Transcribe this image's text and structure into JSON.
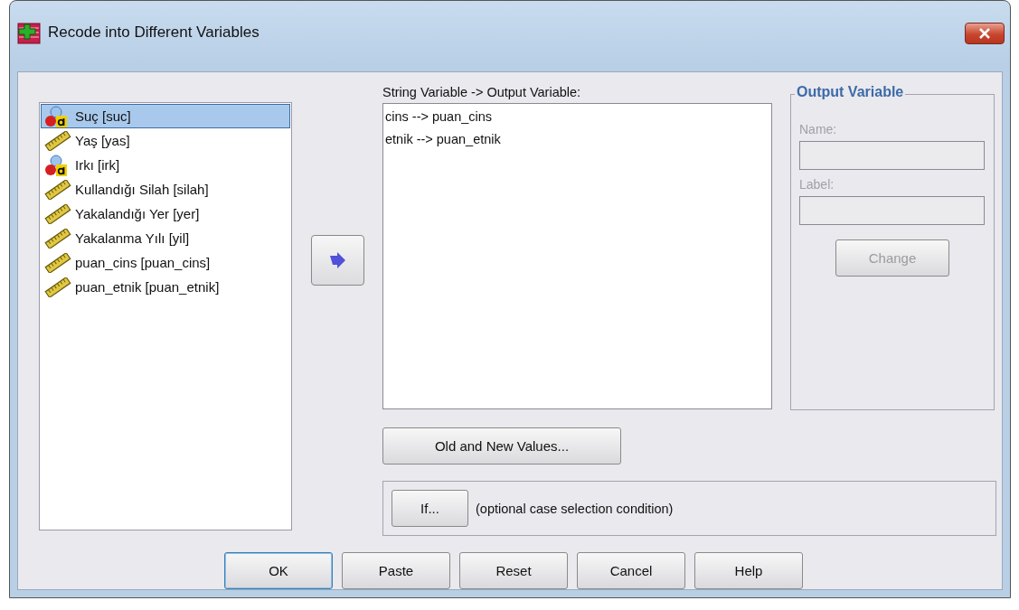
{
  "window": {
    "title": "Recode into Different Variables"
  },
  "variables": [
    {
      "label": "Suç [suc]",
      "kind": "nominal",
      "selected": true
    },
    {
      "label": "Yaş [yas]",
      "kind": "scale",
      "selected": false
    },
    {
      "label": "Irkı [irk]",
      "kind": "nominal",
      "selected": false
    },
    {
      "label": "Kullandığı Silah [silah]",
      "kind": "scale",
      "selected": false
    },
    {
      "label": "Yakalandığı Yer [yer]",
      "kind": "scale",
      "selected": false
    },
    {
      "label": "Yakalanma Yılı [yil]",
      "kind": "scale",
      "selected": false
    },
    {
      "label": "puan_cins [puan_cins]",
      "kind": "scale",
      "selected": false
    },
    {
      "label": "puan_etnik [puan_etnik]",
      "kind": "scale",
      "selected": false
    }
  ],
  "mapping": {
    "label": "String Variable -> Output Variable:",
    "items": [
      "cins --> puan_cins",
      "etnik --> puan_etnik"
    ]
  },
  "output_variable": {
    "title": "Output Variable",
    "name_label": "Name:",
    "label_label": "Label:",
    "change_button": "Change",
    "disabled": true
  },
  "old_new_button": "Old and New Values...",
  "if_button": "If...",
  "if_note": "(optional case selection condition)",
  "buttons": [
    {
      "label": "OK",
      "default": true
    },
    {
      "label": "Paste",
      "default": false
    },
    {
      "label": "Reset",
      "default": false
    },
    {
      "label": "Cancel",
      "default": false
    },
    {
      "label": "Help",
      "default": false
    }
  ]
}
